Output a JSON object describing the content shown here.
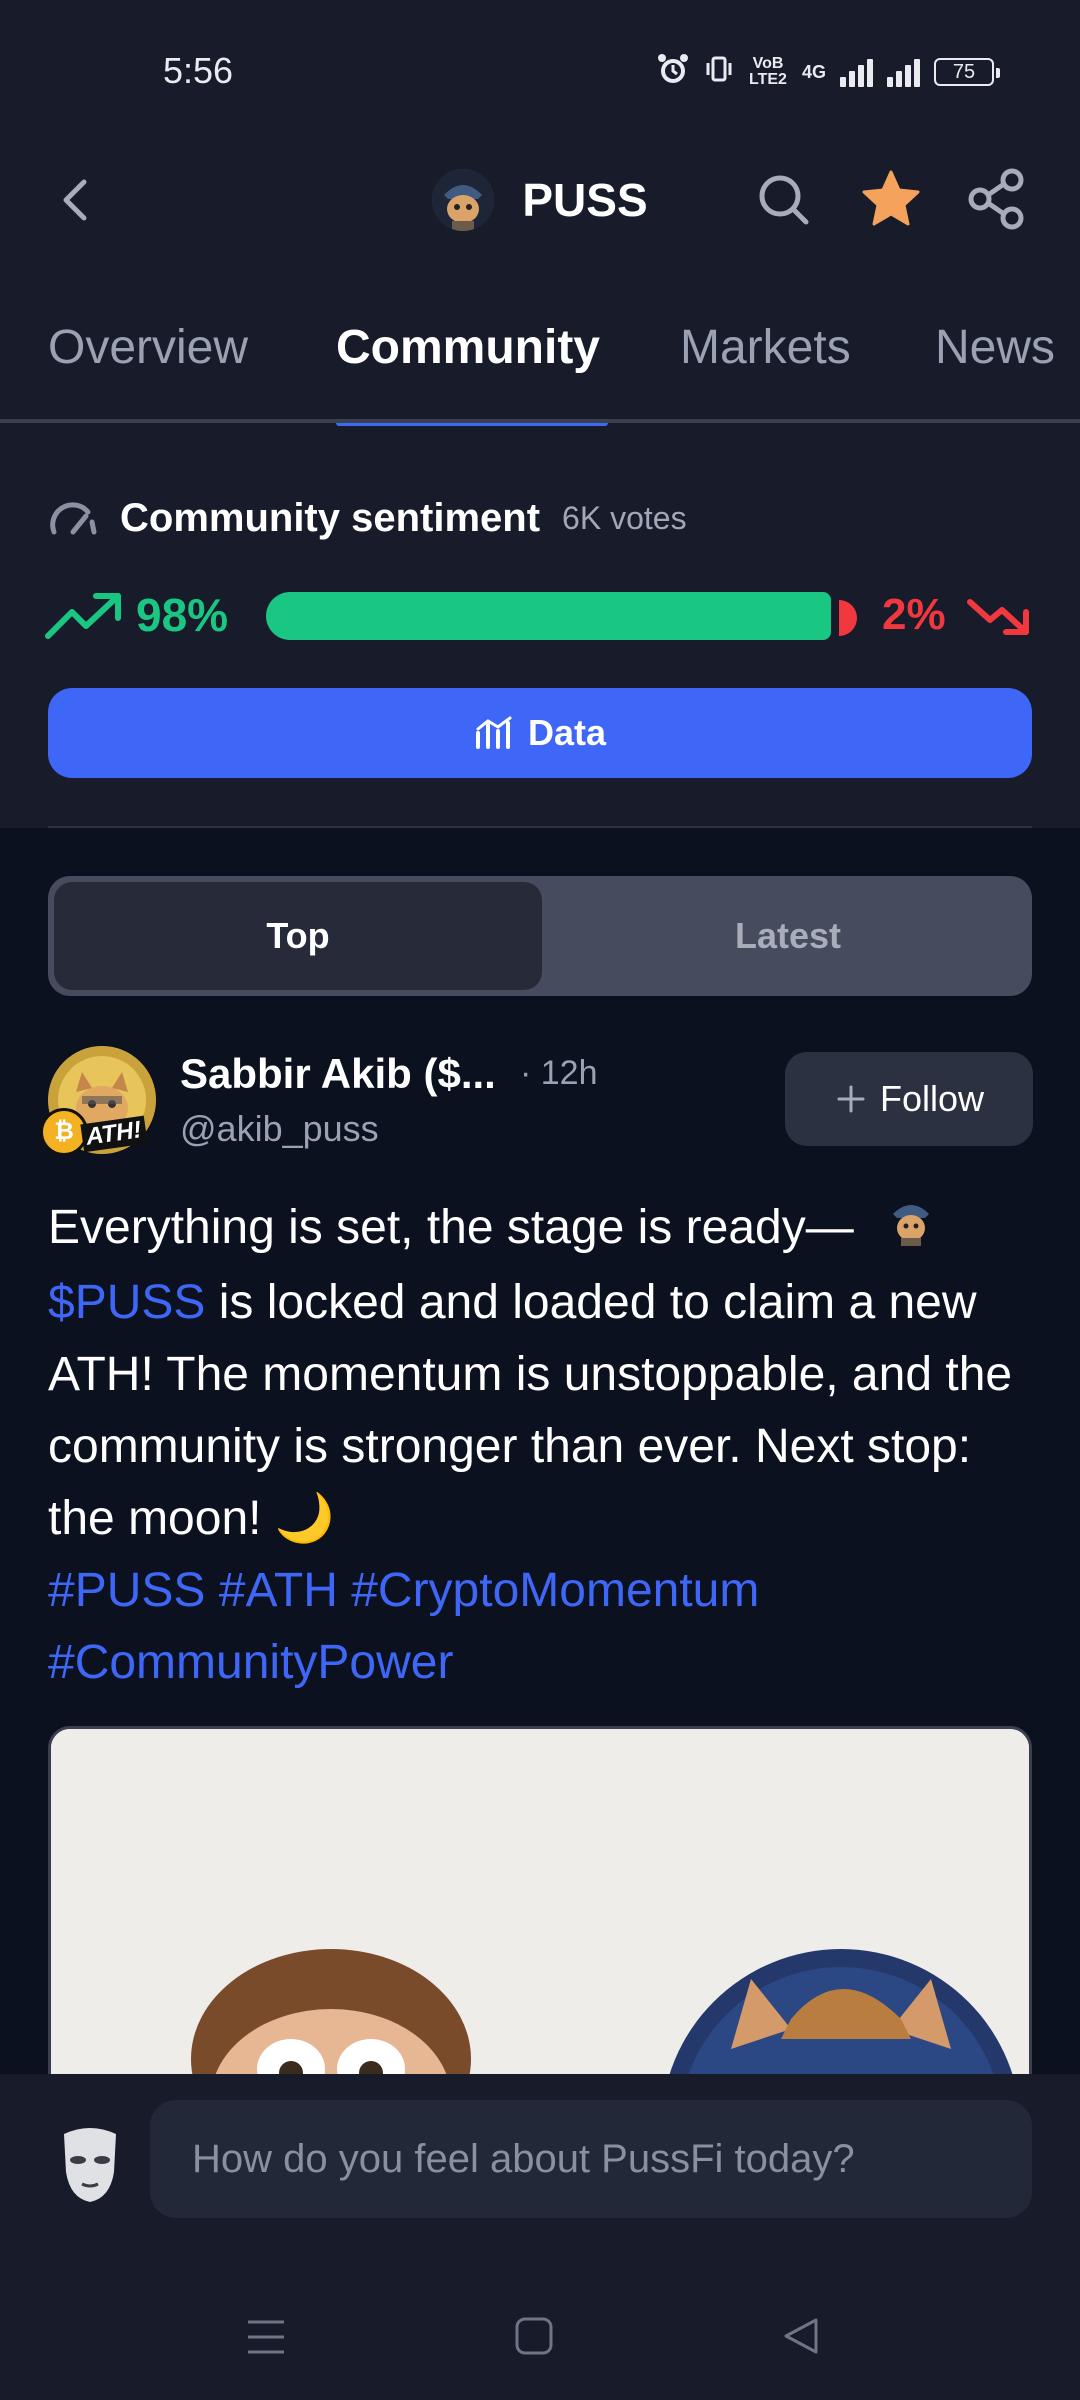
{
  "status_bar": {
    "time": "5:56",
    "network_label": "4G",
    "volte_label": "VoB LTE2",
    "battery": "75"
  },
  "header": {
    "back_icon": "chevron-left-icon",
    "title": "PUSS",
    "coin_icon": "puss-coin-logo",
    "search_icon": "search-icon",
    "favorite_icon": "star-icon",
    "favorite_color": "#f5a25d",
    "share_icon": "share-icon"
  },
  "tabs": [
    {
      "label": "Overview",
      "active": false
    },
    {
      "label": "Community",
      "active": true
    },
    {
      "label": "Markets",
      "active": false
    },
    {
      "label": "News",
      "active": false
    }
  ],
  "sentiment": {
    "icon": "gauge-icon",
    "title": "Community sentiment",
    "votes": "6K votes",
    "bullish_label": "98%",
    "bearish_label": "2%",
    "bullish_fraction": 0.98,
    "bullish_color": "#19c782",
    "bearish_color": "#f0383e"
  },
  "data_button": {
    "label": "Data",
    "icon": "chart-icon"
  },
  "segment": {
    "top": "Top",
    "latest": "Latest",
    "selected": "Top"
  },
  "post": {
    "author_name": "Sabbir Akib ($...",
    "time": "· 12h",
    "handle": "@akib_puss",
    "avatar_badge": "ATH!",
    "follow_label": "Follow",
    "body_part1": "Everything is set, the stage is ready—",
    "cashtag": "$PUSS",
    "body_part2": " is locked and loaded to claim a new ATH! The momentum is unstoppable, and the community is stronger than ever. Next stop: the moon! 🌙",
    "hashtags_line1": "#PUSS #ATH #CryptoMomentum",
    "hashtags_line2": "#CommunityPower"
  },
  "composer": {
    "placeholder": "How do you feel about PussFi today?",
    "avatar_icon": "mask-icon"
  },
  "nav": {
    "menu_icon": "menu-icon",
    "home_icon": "home-square-icon",
    "back_icon": "back-triangle-icon"
  }
}
